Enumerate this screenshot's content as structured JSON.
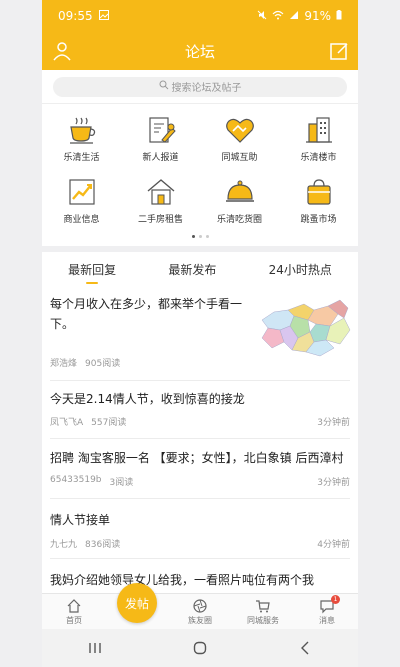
{
  "status": {
    "time": "09:55",
    "battery": "91%"
  },
  "header": {
    "title": "论坛"
  },
  "search": {
    "placeholder": "搜索论坛及帖子"
  },
  "categories": [
    {
      "label": "乐清生活",
      "icon": "coffee-cup-icon"
    },
    {
      "label": "新人报道",
      "icon": "clipboard-pen-icon"
    },
    {
      "label": "同城互助",
      "icon": "heart-hand-icon"
    },
    {
      "label": "乐清楼市",
      "icon": "building-icon"
    },
    {
      "label": "商业信息",
      "icon": "growth-chart-icon"
    },
    {
      "label": "二手房租售",
      "icon": "house-icon"
    },
    {
      "label": "乐清吃货圈",
      "icon": "food-cloche-icon"
    },
    {
      "label": "跳蚤市场",
      "icon": "shopping-bag-icon"
    }
  ],
  "tabs": [
    "最新回复",
    "最新发布",
    "24小时热点"
  ],
  "posts": [
    {
      "title": "每个月收入在多少，都来举个手看一下。",
      "author": "郑浩烽",
      "views": "905阅读",
      "time": ""
    },
    {
      "title": "今天是2.14情人节，收到惊喜的接龙",
      "author": "凤飞飞A",
      "views": "557阅读",
      "time": "3分钟前"
    },
    {
      "title": "招聘 淘宝客服一名 【要求；女性】，北白象镇 后西漳村",
      "author": "65433519b",
      "views": "3阅读",
      "time": "3分钟前"
    },
    {
      "title": "情人节接单",
      "author": "九七九",
      "views": "836阅读",
      "time": "4分钟前"
    },
    {
      "title": "我妈介绍她领导女儿给我，一看照片吨位有两个我",
      "author": "",
      "views": "",
      "time": ""
    }
  ],
  "fab": {
    "label": "发帖"
  },
  "nav": [
    {
      "label": "首页",
      "icon": "home-icon"
    },
    {
      "label": "族友圈",
      "icon": "camera-aperture-icon"
    },
    {
      "label": "同城服务",
      "icon": "cart-icon"
    },
    {
      "label": "消息",
      "icon": "chat-icon",
      "badge": "1"
    }
  ],
  "colors": {
    "accent": "#f6b917",
    "badge": "#e84c3d"
  }
}
